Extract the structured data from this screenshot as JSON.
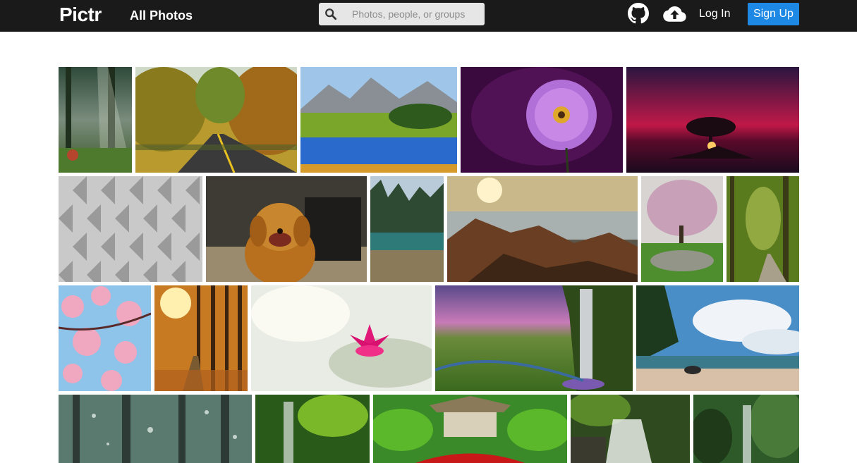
{
  "header": {
    "logo": "Pictr",
    "nav_all_photos": "All Photos",
    "search_placeholder": "Photos, people, or groups",
    "login": "Log In",
    "signup": "Sign Up"
  },
  "icons": {
    "search": "search-icon",
    "github": "github-icon",
    "upload": "cloud-upload-icon"
  },
  "colors": {
    "navbar": "#1a1a1a",
    "signup_button": "#1e88e5",
    "search_bg": "#e6e6e6"
  },
  "photos": [
    {
      "subject": "forest-sunbeams"
    },
    {
      "subject": "autumn-road"
    },
    {
      "subject": "mountain-lake"
    },
    {
      "subject": "purple-daisy"
    },
    {
      "subject": "tree-sunset"
    },
    {
      "subject": "geometric-facade"
    },
    {
      "subject": "golden-retriever"
    },
    {
      "subject": "forest-lake"
    },
    {
      "subject": "rocky-coast"
    },
    {
      "subject": "blossom-tree"
    },
    {
      "subject": "forest-path"
    },
    {
      "subject": "cherry-blossoms"
    },
    {
      "subject": "autumn-forest-sun"
    },
    {
      "subject": "pink-water-lily"
    },
    {
      "subject": "waterfall-valley"
    },
    {
      "subject": "tropical-beach"
    },
    {
      "subject": "rain-window"
    },
    {
      "subject": "jungle-waterfall"
    },
    {
      "subject": "japanese-garden"
    },
    {
      "subject": "cascade-waterfall"
    },
    {
      "subject": "rainforest-waterfall"
    }
  ]
}
